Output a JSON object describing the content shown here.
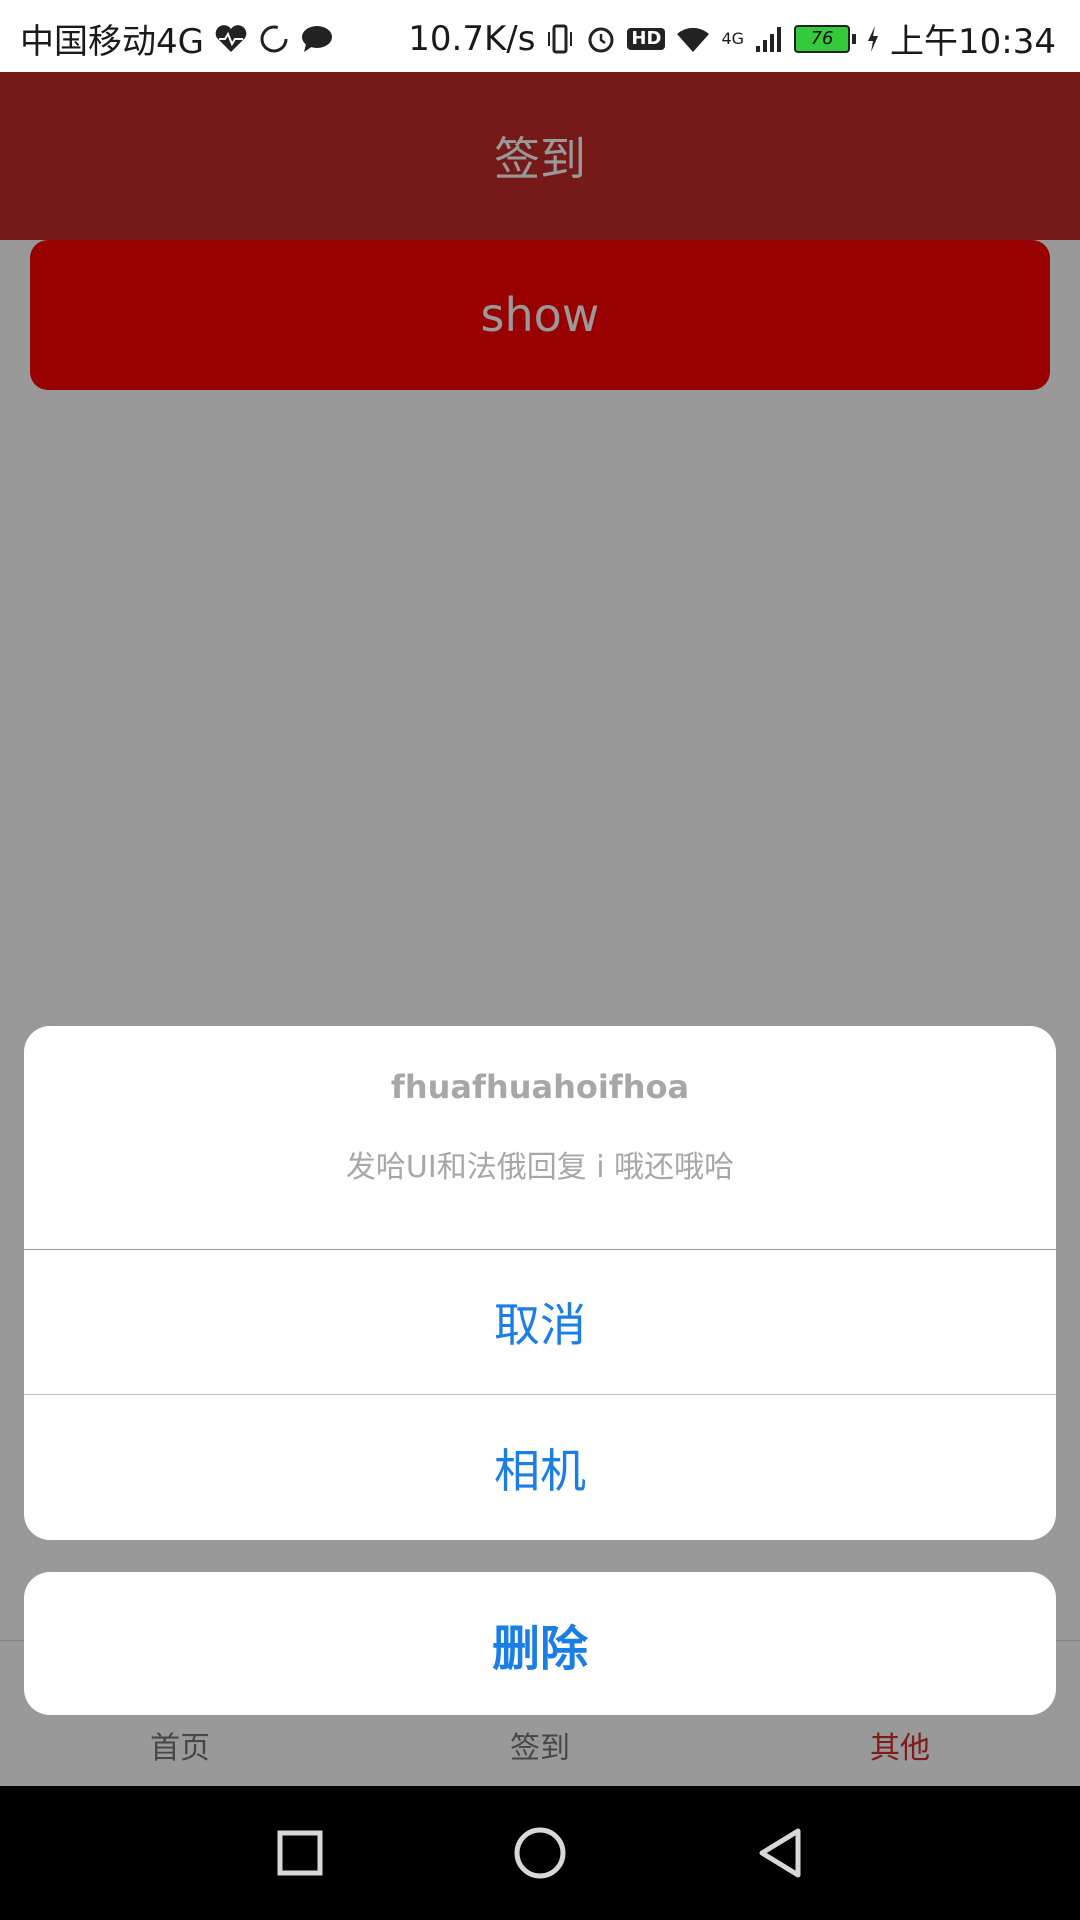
{
  "status_bar": {
    "carrier": "中国移动4G",
    "net_speed": "10.7K/s",
    "hd_label": "HD",
    "network_type": "4G",
    "battery": "76",
    "time": "上午10:34"
  },
  "header": {
    "title": "签到"
  },
  "main": {
    "show_button": "show"
  },
  "tab_bar": {
    "tabs": [
      {
        "label": "首页",
        "icon": "home-icon"
      },
      {
        "label": "签到",
        "icon": "checkin-icon"
      },
      {
        "label": "其他",
        "icon": "other-icon",
        "active": true
      }
    ]
  },
  "action_sheet": {
    "title": "fhuafhuahoifhoa",
    "message": "发哈UI和法俄回复 i 哦还哦哈",
    "actions": [
      "取消",
      "相机"
    ],
    "destructive": "删除"
  },
  "colors": {
    "header": "#c52b2b",
    "show_button": "#ff0000",
    "action_text": "#1a7ee6",
    "active_tab": "#d0312d"
  }
}
